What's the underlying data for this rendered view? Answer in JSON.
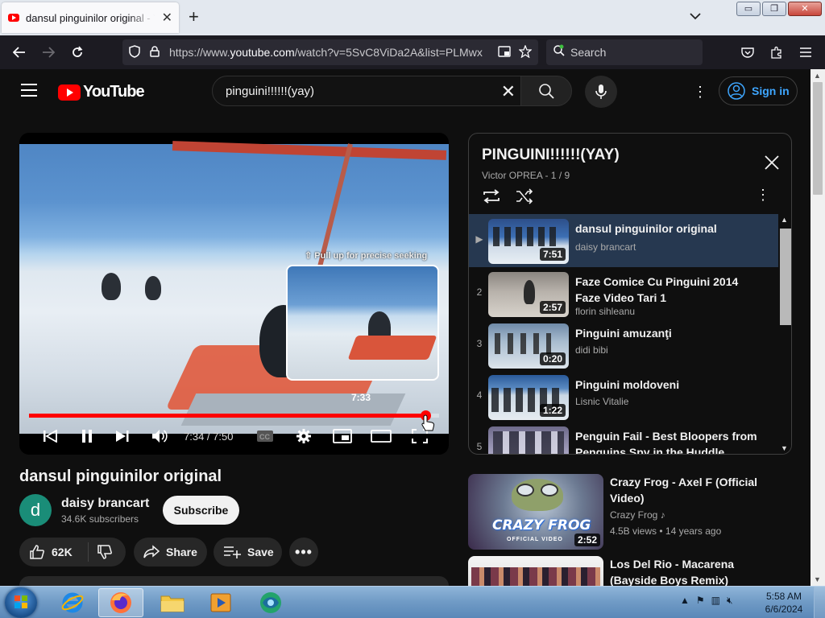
{
  "browser": {
    "tab_title": "dansul pinguinilor original - YouTube",
    "new_tab": "+",
    "url_prefix": "https://www.",
    "url_domain": "youtube.com",
    "url_rest": "/watch?v=5SvC8ViDa2A&list=PLMwx",
    "search_placeholder": "Search",
    "window_minimize": "▭",
    "window_restore": "❐",
    "window_close": "✕"
  },
  "youtube": {
    "logo_text": "YouTube",
    "search_query": "pinguini!!!!!!(yay)",
    "sign_in": "Sign in"
  },
  "player": {
    "seek_hint": "Pull up for precise seeking",
    "preview_time": "7:33",
    "time_current": "7:34",
    "time_total": "7:50",
    "time_display": "7:34 / 7:50",
    "progress_fraction": 0.966
  },
  "video": {
    "title": "dansul pinguinilor original",
    "channel": "daisy brancart",
    "avatar_letter": "d",
    "subscribers": "34.6K subscribers",
    "subscribe": "Subscribe",
    "likes": "62K",
    "share": "Share",
    "save": "Save"
  },
  "playlist": {
    "title": "PINGUINI!!!!!!(YAY)",
    "owner": "Victor OPREA - 1 / 9",
    "items": [
      {
        "index": "▶",
        "title": "dansul pinguinilor original",
        "channel": "daisy brancart",
        "duration": "7:51"
      },
      {
        "index": "2",
        "title": "Faze Comice Cu Pinguini 2014 Faze Video Tari 1",
        "channel": "florin sihleanu",
        "duration": "2:57"
      },
      {
        "index": "3",
        "title": "Pinguini amuzanţi",
        "channel": "didi bibi",
        "duration": "0:20"
      },
      {
        "index": "4",
        "title": "Pinguini moldoveni",
        "channel": "Lisnic Vitalie",
        "duration": "1:22"
      },
      {
        "index": "5",
        "title": "Penguin Fail - Best Bloopers from Penguins Spy in the Huddle",
        "channel": "",
        "duration": ""
      }
    ]
  },
  "related": [
    {
      "title": "Crazy Frog - Axel F (Official Video)",
      "channel": "Crazy Frog ♪",
      "meta": "4.5B views • 14 years ago",
      "duration": "2:52",
      "thumb_text": "CRAZY FROG",
      "thumb_sub": "OFFICIAL VIDEO"
    },
    {
      "title": "Los Del Rio - Macarena (Bayside Boys Remix)",
      "channel": "",
      "meta": "",
      "duration": "",
      "thumb_text": "",
      "thumb_sub": ""
    }
  ],
  "taskbar": {
    "time": "5:58 AM",
    "date": "6/6/2024"
  },
  "colors": {
    "yt_red": "#ff0000",
    "link_blue": "#3ea6ff",
    "active_row": "#263850"
  }
}
